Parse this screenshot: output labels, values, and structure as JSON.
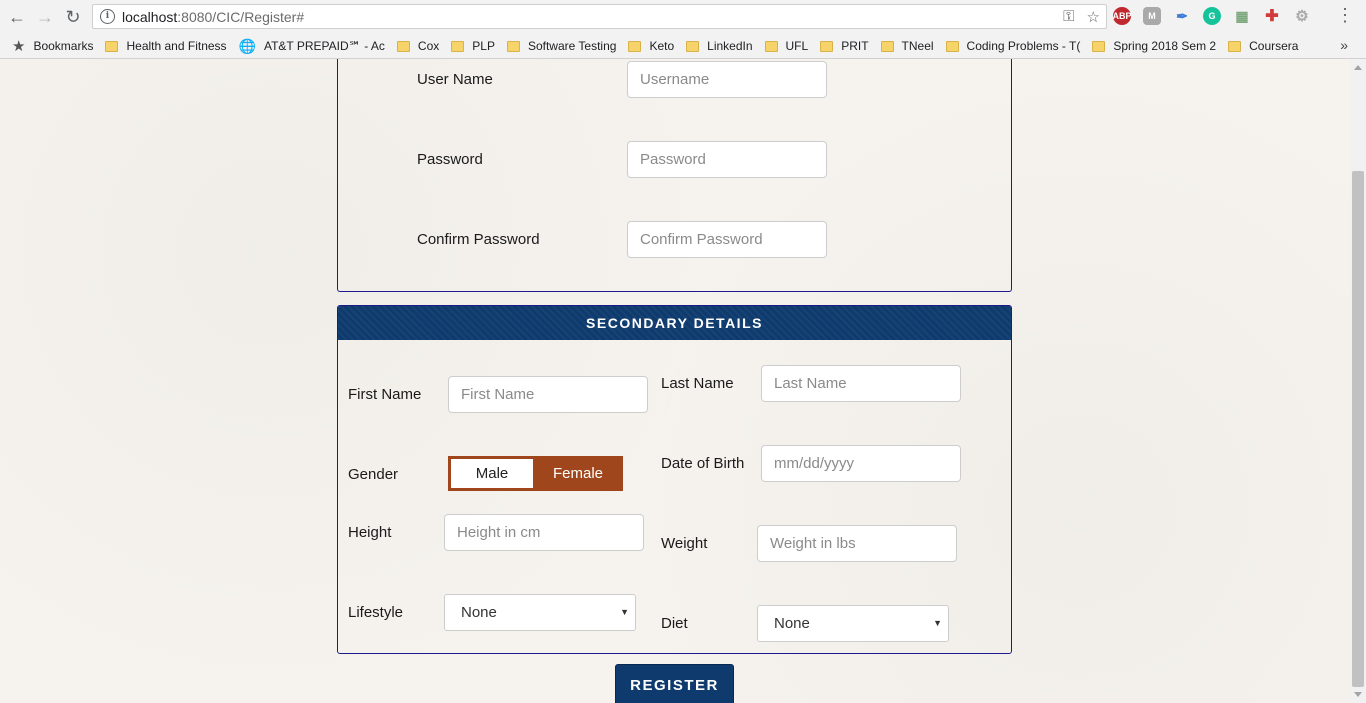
{
  "browser": {
    "url_host": "localhost",
    "url_rest": ":8080/CIC/Register#",
    "bookmarks": [
      {
        "label": "Bookmarks",
        "icon": "star-icon"
      },
      {
        "label": "Health and Fitness",
        "icon": "folder-icon"
      },
      {
        "label": "AT&T PREPAID℠ - Ac",
        "icon": "att-icon"
      },
      {
        "label": "Cox",
        "icon": "folder-icon"
      },
      {
        "label": "PLP",
        "icon": "folder-icon"
      },
      {
        "label": "Software Testing",
        "icon": "folder-icon"
      },
      {
        "label": "Keto",
        "icon": "folder-icon"
      },
      {
        "label": "LinkedIn",
        "icon": "folder-icon"
      },
      {
        "label": "UFL",
        "icon": "folder-icon"
      },
      {
        "label": "PRIT",
        "icon": "folder-icon"
      },
      {
        "label": "TNeel",
        "icon": "folder-icon"
      },
      {
        "label": "Coding Problems - T(",
        "icon": "folder-icon"
      },
      {
        "label": "Spring 2018 Sem 2",
        "icon": "folder-icon"
      },
      {
        "label": "Coursera",
        "icon": "folder-icon"
      }
    ],
    "more": "»",
    "extensions": {
      "abp": "ABP",
      "m": "M"
    }
  },
  "primary": {
    "username_label": "User Name",
    "username_placeholder": "Username",
    "password_label": "Password",
    "password_placeholder": "Password",
    "confirm_label": "Confirm Password",
    "confirm_placeholder": "Confirm Password"
  },
  "secondary": {
    "header": "SECONDARY DETAILS",
    "first_name_label": "First Name",
    "first_name_placeholder": "First Name",
    "last_name_label": "Last Name",
    "last_name_placeholder": "Last Name",
    "gender_label": "Gender",
    "gender_male": "Male",
    "gender_female": "Female",
    "gender_selected": "Female",
    "dob_label": "Date of Birth",
    "dob_placeholder": "mm/dd/yyyy",
    "height_label": "Height",
    "height_placeholder": "Height in cm",
    "weight_label": "Weight",
    "weight_placeholder": "Weight in lbs",
    "lifestyle_label": "Lifestyle",
    "lifestyle_value": "None",
    "diet_label": "Diet",
    "diet_value": "None"
  },
  "register_label": "REGISTER",
  "colors": {
    "header_blue": "#0e3a6e",
    "border_navy": "#1f1a8c",
    "gender_accent": "#a0461d"
  }
}
